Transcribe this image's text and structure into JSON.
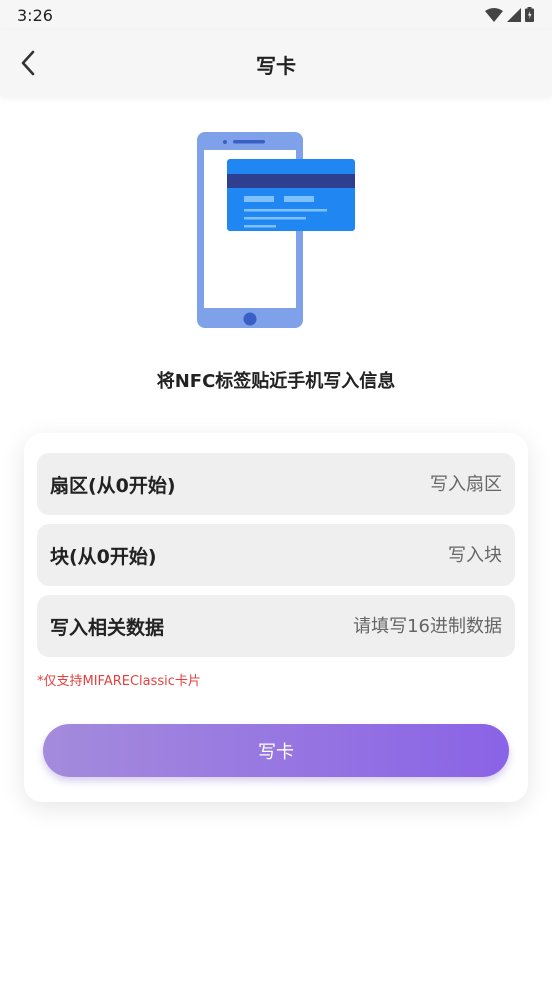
{
  "status_bar": {
    "time": "3:26"
  },
  "header": {
    "title": "写卡"
  },
  "hint": "将NFC标签贴近手机写入信息",
  "form": {
    "sector": {
      "label": "扇区(从0开始)",
      "placeholder": "写入扇区"
    },
    "block": {
      "label": "块(从0开始)",
      "placeholder": "写入块"
    },
    "data": {
      "label": "写入相关数据",
      "placeholder": "请填写16进制数据"
    }
  },
  "note": "*仅支持MIFAREClassic卡片",
  "write_button": "写卡",
  "colors": {
    "accent_start": "#a48bdc",
    "accent_end": "#8a63e6",
    "note": "#e54040",
    "phone": "#7fa1ea",
    "card": "#1f86f2",
    "card_stripe": "#2f3f8f"
  }
}
